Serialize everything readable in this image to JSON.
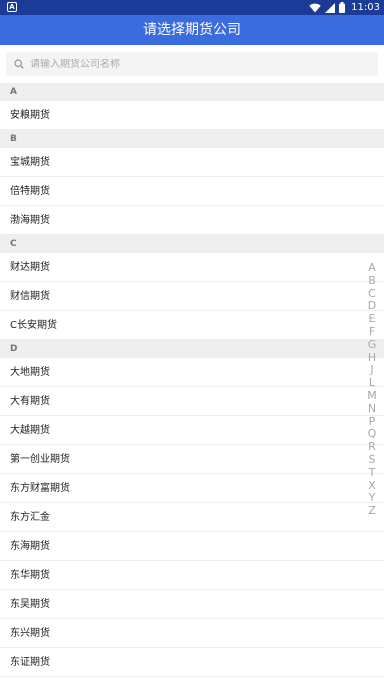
{
  "status_bar": {
    "notification_icon_label": "A",
    "time": "11:03"
  },
  "app_bar": {
    "title": "请选择期货公司"
  },
  "search": {
    "placeholder": "请输入期货公司名称"
  },
  "sections": [
    {
      "letter": "A",
      "items": [
        "安粮期货"
      ]
    },
    {
      "letter": "B",
      "items": [
        "宝城期货",
        "倍特期货",
        "渤海期货"
      ]
    },
    {
      "letter": "C",
      "items": [
        "财达期货",
        "财信期货",
        "C长安期货"
      ]
    },
    {
      "letter": "D",
      "items": [
        "大地期货",
        "大有期货",
        "大越期货",
        "第一创业期货",
        "东方财富期货",
        "东方汇金",
        "东海期货",
        "东华期货",
        "东吴期货",
        "东兴期货",
        "东证期货"
      ]
    }
  ],
  "index_letters": [
    "A",
    "B",
    "C",
    "D",
    "E",
    "F",
    "G",
    "H",
    "J",
    "L",
    "M",
    "N",
    "P",
    "Q",
    "R",
    "S",
    "T",
    "X",
    "Y",
    "Z"
  ],
  "colors": {
    "status_bar": "#1b3b96",
    "app_bar": "#3a6ce0",
    "section_header_bg": "#efefef",
    "index_text": "#a8a8a8"
  }
}
